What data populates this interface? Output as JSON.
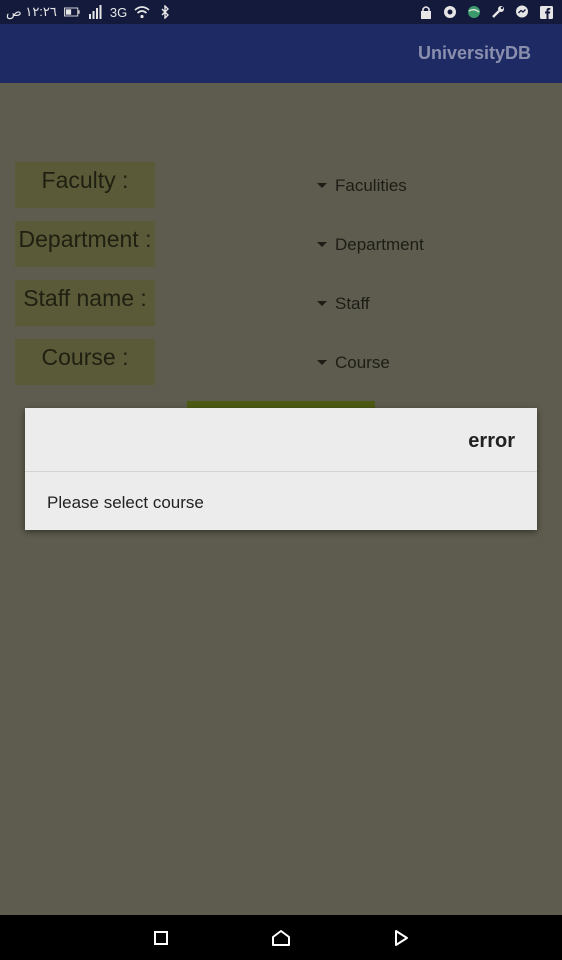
{
  "status_bar": {
    "time": "١٢:٢٦ ص",
    "network": "3G",
    "left_icons": [
      "battery-icon",
      "signal-icon",
      "wifi-icon",
      "bluetooth-icon"
    ],
    "right_icons": [
      "lock-icon",
      "chrome-icon",
      "globe-icon",
      "wrench-icon",
      "messenger-icon",
      "facebook-icon"
    ]
  },
  "app_bar": {
    "title": "UniversityDB"
  },
  "form": {
    "labels": [
      "Faculty :",
      "Department :",
      "Staff name :",
      "Course :"
    ],
    "spinners": [
      "Faculities",
      "Department",
      "Staff",
      "Course"
    ]
  },
  "dialog": {
    "title": "error",
    "message": "Please select course"
  },
  "nav_bar": {
    "icons": [
      "recents-icon",
      "home-icon",
      "back-icon"
    ]
  },
  "colors": {
    "app_bar": "#1d2a63",
    "status_bar": "#141a3c",
    "background_dimmed": "#5d5c4e",
    "label_box": "#5a5a38",
    "button": "#4c5a14",
    "dialog_bg": "#ececec"
  }
}
